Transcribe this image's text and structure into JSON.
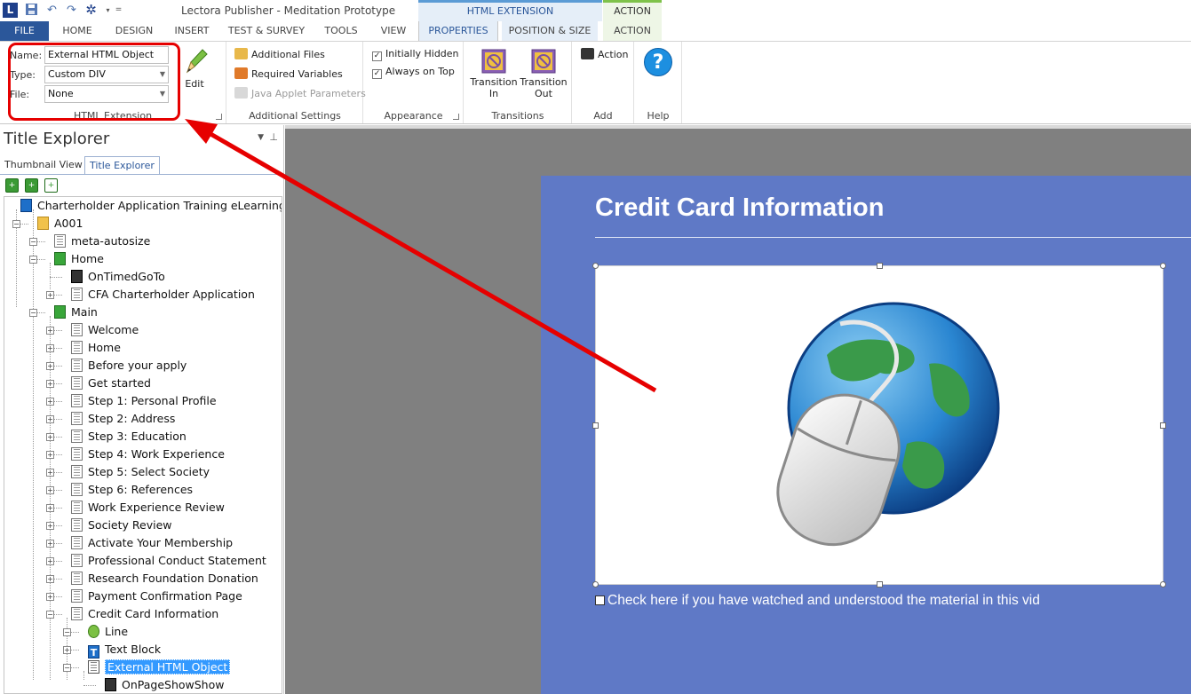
{
  "window": {
    "title": "Lectora Publisher - Meditation Prototype"
  },
  "app_logo": "L",
  "contextual": {
    "html_extension": "HTML EXTENSION",
    "action": "ACTION"
  },
  "tabs": {
    "file": "FILE",
    "home": "HOME",
    "design": "DESIGN",
    "insert": "INSERT",
    "test_survey": "TEST & SURVEY",
    "tools": "TOOLS",
    "view": "VIEW",
    "properties": "PROPERTIES",
    "position_size": "POSITION & SIZE",
    "action": "ACTION"
  },
  "ribbon": {
    "html_extension": {
      "name_label": "Name:",
      "name_value": "External HTML Object",
      "type_label": "Type:",
      "type_value": "Custom DIV",
      "file_label": "File:",
      "file_value": "None",
      "edit_label": "Edit",
      "group_label": "HTML Extension"
    },
    "additional_settings": {
      "additional_files": "Additional Files",
      "required_variables": "Required Variables",
      "java_applet_parameters": "Java Applet Parameters",
      "group_label": "Additional Settings"
    },
    "appearance": {
      "initially_hidden": "Initially Hidden",
      "always_on_top": "Always on Top",
      "group_label": "Appearance"
    },
    "transitions": {
      "transition_in": "Transition In",
      "transition_out": "Transition Out",
      "group_label": "Transitions"
    },
    "add": {
      "action": "Action",
      "group_label": "Add"
    },
    "help": {
      "help_glyph": "?",
      "group_label": "Help"
    }
  },
  "left_panel": {
    "title": "Title Explorer",
    "tabs": {
      "thumbnail": "Thumbnail View",
      "explorer": "Title Explorer"
    },
    "tree": [
      {
        "label": "Charterholder Application Training eLearning",
        "icon": "book-icon"
      },
      {
        "label": "A001",
        "icon": "folder-icon"
      },
      {
        "label": "meta-autosize",
        "icon": "page-icon"
      },
      {
        "label": "Home",
        "icon": "chapter-icon"
      },
      {
        "label": "OnTimedGoTo",
        "icon": "action-icon"
      },
      {
        "label": "CFA Charterholder Application",
        "icon": "page-icon"
      },
      {
        "label": "Main",
        "icon": "chapter-icon"
      },
      {
        "label": "Welcome",
        "icon": "page-icon"
      },
      {
        "label": "Home",
        "icon": "page-icon"
      },
      {
        "label": "Before your apply",
        "icon": "page-icon"
      },
      {
        "label": "Get started",
        "icon": "page-icon"
      },
      {
        "label": "Step 1: Personal Profile",
        "icon": "page-icon"
      },
      {
        "label": "Step 2: Address",
        "icon": "page-icon"
      },
      {
        "label": "Step 3: Education",
        "icon": "page-icon"
      },
      {
        "label": "Step 4: Work Experience",
        "icon": "page-icon"
      },
      {
        "label": "Step 5: Select Society",
        "icon": "page-icon"
      },
      {
        "label": "Step 6:  References",
        "icon": "page-icon"
      },
      {
        "label": "Work Experience Review",
        "icon": "page-icon"
      },
      {
        "label": "Society Review",
        "icon": "page-icon"
      },
      {
        "label": "Activate Your Membership",
        "icon": "page-icon"
      },
      {
        "label": "Professional Conduct Statement",
        "icon": "page-icon"
      },
      {
        "label": "Research Foundation Donation",
        "icon": "page-icon"
      },
      {
        "label": "Payment Confirmation Page",
        "icon": "page-icon"
      },
      {
        "label": "Credit Card Information",
        "icon": "page-icon"
      },
      {
        "label": "Line",
        "icon": "line-icon"
      },
      {
        "label": "Text Block",
        "icon": "text-icon"
      },
      {
        "label": "External HTML Object",
        "icon": "html-icon",
        "selected": true
      },
      {
        "label": "OnPageShowShow",
        "icon": "action-icon"
      }
    ]
  },
  "page": {
    "title": "Credit Card Information",
    "checkbox_text": "Check here if you have watched and understood the material in this vid"
  },
  "colors": {
    "accent": "#2b579a",
    "page_bg": "#5f79c6",
    "canvas_bg": "#808080",
    "highlight": "#e60000",
    "selection": "#3399ff"
  }
}
